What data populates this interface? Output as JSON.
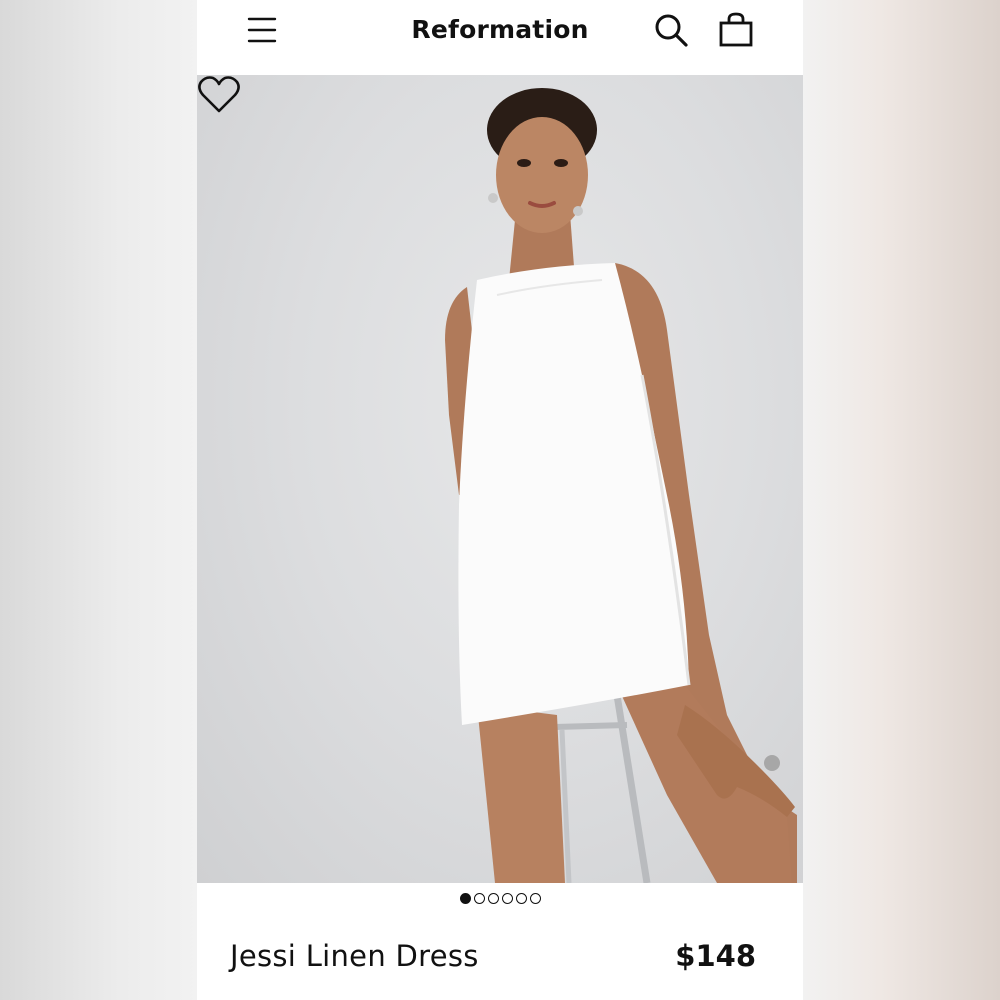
{
  "header": {
    "brand": "Reformation",
    "menu_icon": "hamburger-menu-icon",
    "search_icon": "search-icon",
    "bag_icon": "shopping-bag-icon"
  },
  "gallery": {
    "favorite_icon": "heart-icon",
    "image_count": 6,
    "active_index": 0
  },
  "product": {
    "name": "Jessi Linen Dress",
    "price": "$148"
  }
}
